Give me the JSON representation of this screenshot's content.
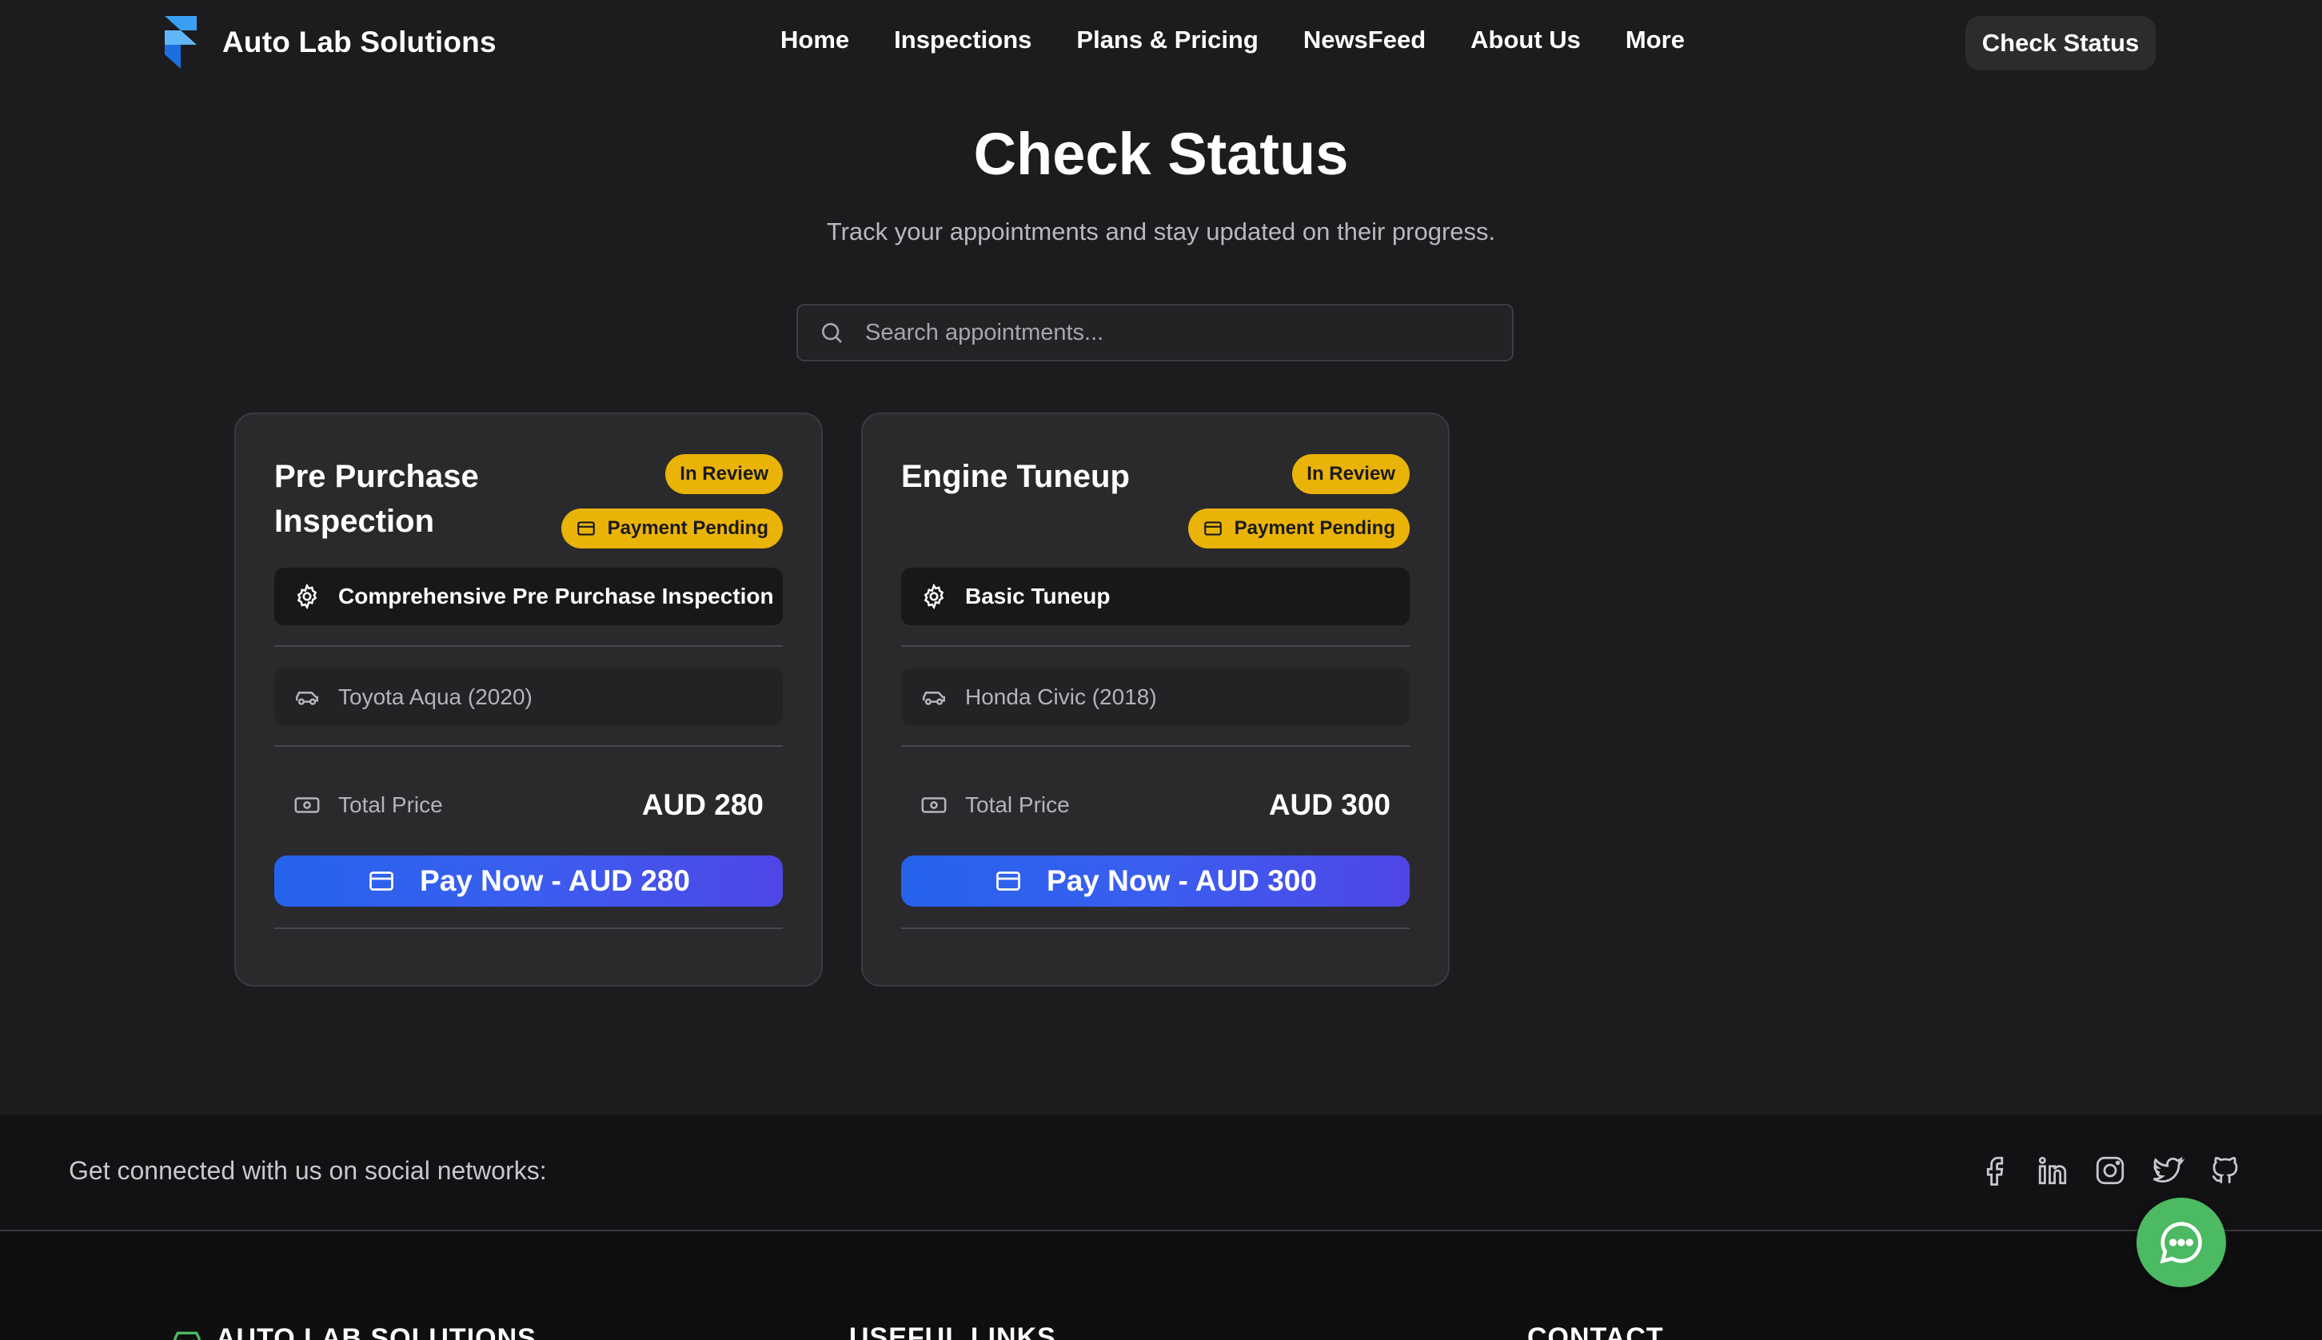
{
  "brand": {
    "name": "Auto Lab Solutions",
    "logo_icon": "framer-logo-icon"
  },
  "nav": {
    "items": [
      "Home",
      "Inspections",
      "Plans & Pricing",
      "NewsFeed",
      "About Us",
      "More"
    ],
    "cta": "Check Status"
  },
  "hero": {
    "title": "Check Status",
    "subtitle": "Track your appointments and stay updated on their progress."
  },
  "search": {
    "placeholder": "Search appointments...",
    "value": ""
  },
  "cards": [
    {
      "title": "Pre Purchase Inspection",
      "status_badge": "In Review",
      "payment_badge": "Payment Pending",
      "service": "Comprehensive Pre Purchase Inspection",
      "vehicle": "Toyota Aqua (2020)",
      "price_label": "Total Price",
      "price": "AUD 280",
      "pay_label": "Pay Now - AUD 280"
    },
    {
      "title": "Engine Tuneup",
      "status_badge": "In Review",
      "payment_badge": "Payment Pending",
      "service": "Basic Tuneup",
      "vehicle": "Honda Civic (2018)",
      "price_label": "Total Price",
      "price": "AUD 300",
      "pay_label": "Pay Now - AUD 300"
    }
  ],
  "footer": {
    "social_text": "Get connected with us on social networks:",
    "social_icons": [
      "facebook-icon",
      "linkedin-icon",
      "instagram-icon",
      "twitter-icon",
      "github-icon"
    ],
    "columns": [
      "AUTO LAB SOLUTIONS",
      "USEFUL LINKS",
      "CONTACT"
    ]
  },
  "colors": {
    "background": "#1c1c1e",
    "badge": "#eab308",
    "pay_button": "#2563eb",
    "chat_button": "#4cb963"
  }
}
